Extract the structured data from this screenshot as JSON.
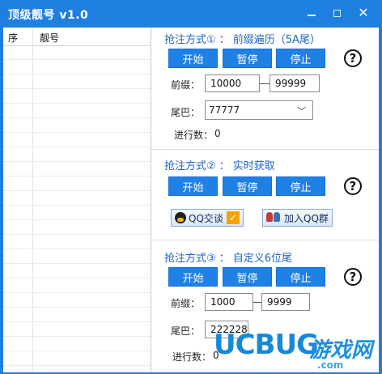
{
  "window": {
    "title": "顶级靓号 v1.0",
    "min_icon": "minimize-icon",
    "max_icon": "maximize-icon",
    "close_label": "✕"
  },
  "list": {
    "columns": [
      "序",
      "靓号"
    ]
  },
  "section1": {
    "title": "抢注方式①",
    "desc": "：  前缀遍历（5A尾）",
    "buttons": {
      "start": "开始",
      "pause": "暂停",
      "stop": "停止"
    },
    "help": "?",
    "prefix_label": "前缀：",
    "prefix_from": "10000",
    "prefix_to": "99999",
    "suffix_label": "尾巴：",
    "suffix_selected": "77777",
    "progress_label": "进行数：",
    "progress_value": "0"
  },
  "section2": {
    "title": "抢注方式②",
    "desc": "：  实时获取",
    "buttons": {
      "start": "开始",
      "pause": "暂停",
      "stop": "停止"
    },
    "help": "?",
    "qq_chat": "QQ交谈",
    "join_group": "加入QQ群"
  },
  "section3": {
    "title": "抢注方式③",
    "desc": "：  自定义6位尾",
    "buttons": {
      "start": "开始",
      "pause": "暂停",
      "stop": "停止"
    },
    "help": "?",
    "prefix_label": "前缀：",
    "prefix_from": "1000",
    "prefix_to": "9999",
    "suffix_label": "尾巴：",
    "suffix_value": "222228",
    "progress_label": "进行数：",
    "progress_value": "0"
  },
  "watermark": {
    "brand": "UCBUG",
    "cn": "游戏网",
    "domain": ".com"
  },
  "colors": {
    "accent": "#1e7fe0",
    "button": "#1f80e6",
    "section_title": "#1f63c6"
  }
}
